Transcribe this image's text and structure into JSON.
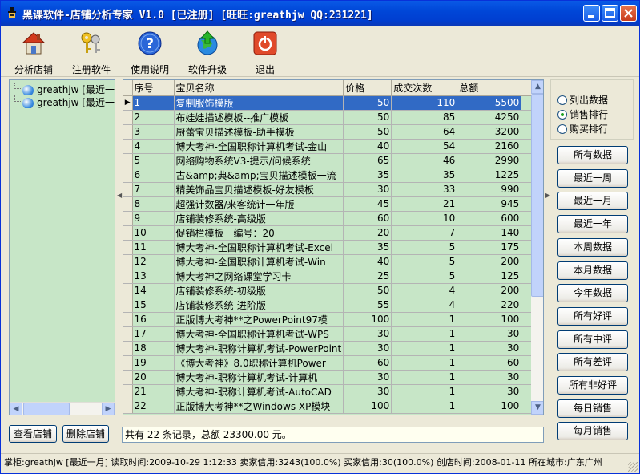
{
  "window": {
    "title": "黑课软件-店铺分析专家 V1.0 [已注册] [旺旺:greathjw QQ:231221]"
  },
  "toolbar": {
    "analyze_label": "分析店铺",
    "register_label": "注册软件",
    "help_label": "使用说明",
    "upgrade_label": "软件升级",
    "exit_label": "退出"
  },
  "tree": {
    "items": [
      {
        "label": "greathjw [最近一周]"
      },
      {
        "label": "greathjw [最近一月]"
      }
    ]
  },
  "grid": {
    "columns": [
      "序号",
      "宝贝名称",
      "价格",
      "成交次数",
      "总额"
    ],
    "selected_row": 0,
    "rows": [
      [
        "1",
        "复制服饰模版",
        "50",
        "110",
        "5500"
      ],
      [
        "2",
        "布娃娃描述模板--推广模板",
        "50",
        "85",
        "4250"
      ],
      [
        "3",
        "厨蕾宝贝描述模板-助手模板",
        "50",
        "64",
        "3200"
      ],
      [
        "4",
        "博大考神-全国职称计算机考试-金山",
        "40",
        "54",
        "2160"
      ],
      [
        "5",
        "网络购物系统V3-提示/问候系统",
        "65",
        "46",
        "2990"
      ],
      [
        "6",
        "古&amp;典&amp;宝贝描述模板一流",
        "35",
        "35",
        "1225"
      ],
      [
        "7",
        "精美饰品宝贝描述模板-好友模板",
        "30",
        "33",
        "990"
      ],
      [
        "8",
        "超强计数器/来客统计一年版",
        "45",
        "21",
        "945"
      ],
      [
        "9",
        "店铺装修系统-高级版",
        "60",
        "10",
        "600"
      ],
      [
        "10",
        "促销栏模板一编号：20",
        "20",
        "7",
        "140"
      ],
      [
        "11",
        "博大考神-全国职称计算机考试-Excel",
        "35",
        "5",
        "175"
      ],
      [
        "12",
        "博大考神-全国职称计算机考试-Win",
        "40",
        "5",
        "200"
      ],
      [
        "13",
        "博大考神之网络课堂学习卡",
        "25",
        "5",
        "125"
      ],
      [
        "14",
        "店铺装修系统-初级版",
        "50",
        "4",
        "200"
      ],
      [
        "15",
        "店铺装修系统-进阶版",
        "55",
        "4",
        "220"
      ],
      [
        "16",
        "正版博大考神**之PowerPoint97模",
        "100",
        "1",
        "100"
      ],
      [
        "17",
        "博大考神-全国职称计算机考试-WPS",
        "30",
        "1",
        "30"
      ],
      [
        "18",
        "博大考神-职称计算机考试-PowerPoint",
        "30",
        "1",
        "30"
      ],
      [
        "19",
        "《博大考神》8.0职称计算机Power",
        "60",
        "1",
        "60"
      ],
      [
        "20",
        "博大考神-职称计算机考试-计算机",
        "30",
        "1",
        "30"
      ],
      [
        "21",
        "博大考神-职称计算机考试-AutoCAD",
        "30",
        "1",
        "30"
      ],
      [
        "22",
        "正版博大考神**之Windows XP模块",
        "100",
        "1",
        "100"
      ]
    ]
  },
  "options": {
    "list_data": "列出数据",
    "sales_rank": "销售排行",
    "buy_rank": "购买排行",
    "selected": "销售排行"
  },
  "side_buttons": [
    "所有数据",
    "最近一周",
    "最近一月",
    "最近一年",
    "本周数据",
    "本月数据",
    "今年数据",
    "所有好评",
    "所有中评",
    "所有差评",
    "所有非好评",
    "每日销售",
    "每月销售"
  ],
  "bottom": {
    "view_shop": "查看店铺",
    "delete_shop": "删除店铺",
    "summary": "共有 22 条记录，总额 23300.00 元。"
  },
  "status": {
    "text": "掌柜:greathjw [最近一月] 读取时间:2009-10-29 1:12:33 卖家信用:3243(100.0%) 买家信用:30(100.0%) 创店时间:2008-01-11 所在城市:广东广州"
  }
}
